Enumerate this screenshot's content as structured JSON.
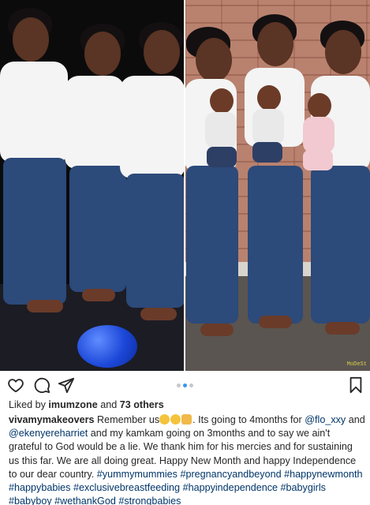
{
  "post": {
    "photo": {
      "watermark": "MoDeSt",
      "colors": {
        "brick": "#b9826f",
        "studio_bg": "#0b0b0c",
        "balloon": "#1c47d8"
      }
    },
    "actions": {
      "like_icon": "heart-icon",
      "comment_icon": "comment-icon",
      "share_icon": "send-icon",
      "save_icon": "bookmark-icon",
      "carousel_dots": 3,
      "active_dot": 2
    },
    "likes": {
      "prefix": "Liked by",
      "user": "imumzone",
      "joiner": "and",
      "others": "73 others"
    },
    "caption": {
      "user": "vivamymakeovers",
      "text_1": " Remember us",
      "text_2": ". Its going to 4months for ",
      "mention_1": "@flo_xxy",
      "text_3": " and ",
      "mention_2": "@ekenyereharriet",
      "text_4": " and my kamkam going on 3months and to say we ain't grateful to God would be a lie. We thank him for his mercies and for sustaining us this far. We are all doing great. Happy New Month and happy Independence to our dear country. ",
      "hashtags": [
        "#yummymummies",
        "#pregnancyandbeyond",
        "#happynewmonth",
        "#happybabies",
        "#exclusivebreastfeeding",
        "#happyindependence",
        "#babygirls",
        "#babyboy",
        "#wethankGod",
        "#strongbabies"
      ]
    },
    "colors": {
      "link": "#003569",
      "active_dot": "#3897f0",
      "text": "#262626"
    }
  }
}
